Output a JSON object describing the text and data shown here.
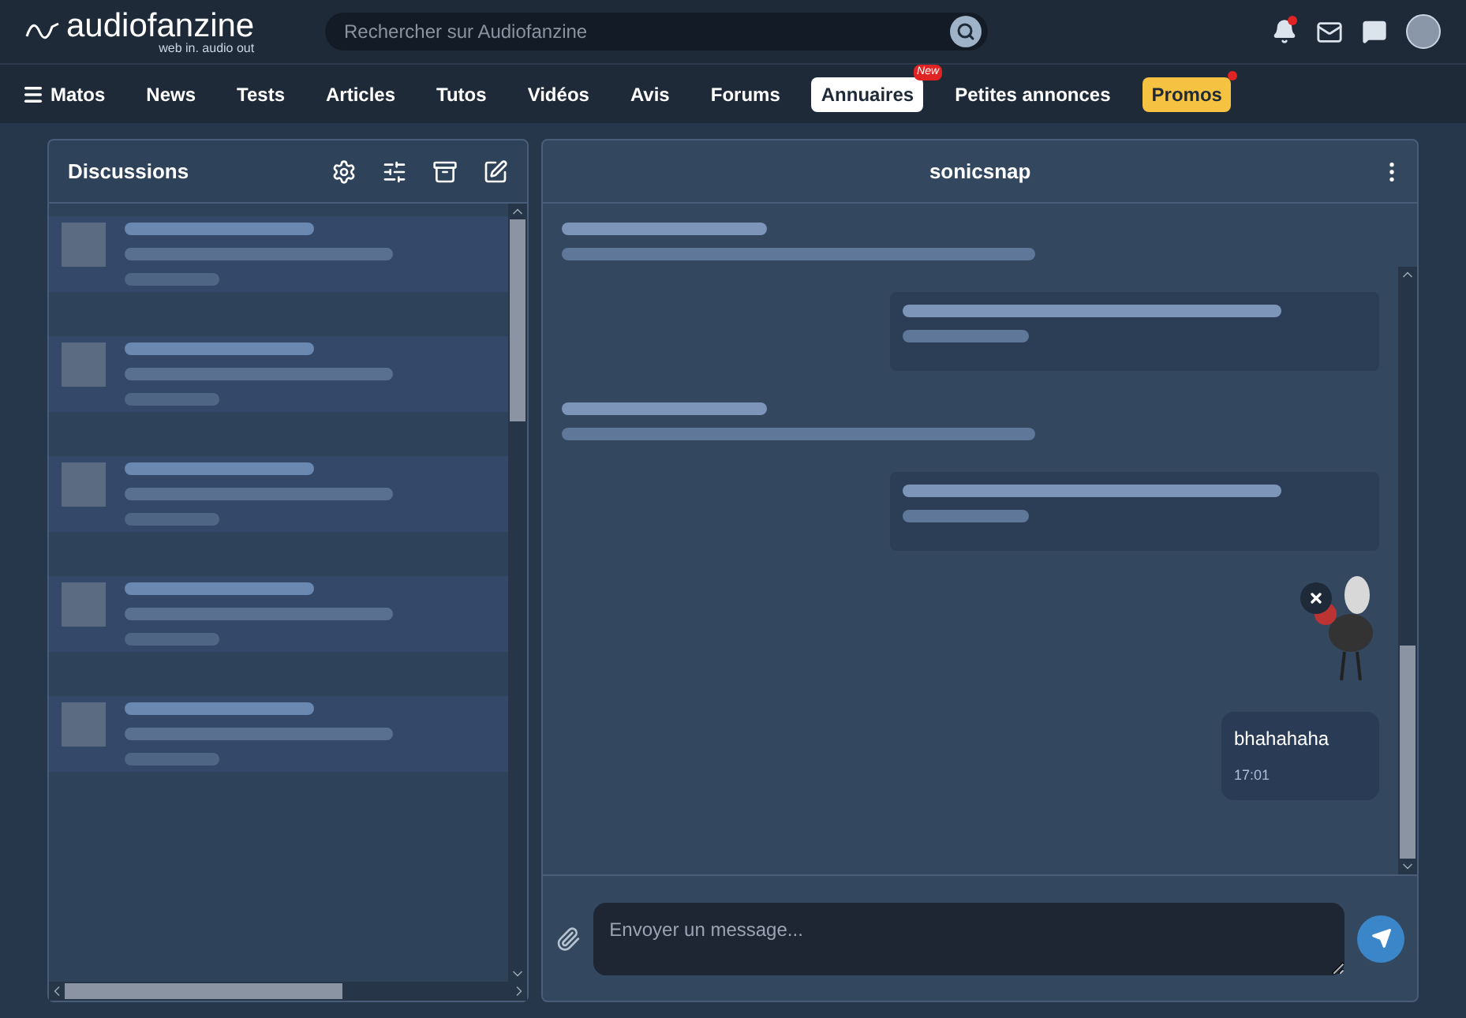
{
  "header": {
    "logo": "audiofanzine",
    "tagline": "web in. audio out",
    "search": {
      "placeholder": "Rechercher sur Audiofanzine"
    },
    "notifications_dot": true
  },
  "nav": [
    {
      "label": "Matos",
      "kind": "menu"
    },
    {
      "label": "News",
      "kind": "plain"
    },
    {
      "label": "Tests",
      "kind": "plain"
    },
    {
      "label": "Articles",
      "kind": "plain"
    },
    {
      "label": "Tutos",
      "kind": "plain"
    },
    {
      "label": "Vidéos",
      "kind": "plain"
    },
    {
      "label": "Avis",
      "kind": "plain"
    },
    {
      "label": "Forums",
      "kind": "plain"
    },
    {
      "label": "Annuaires",
      "kind": "highlight",
      "badge": "New"
    },
    {
      "label": "Petites annonces",
      "kind": "plain"
    },
    {
      "label": "Promos",
      "kind": "promo",
      "dot": true
    }
  ],
  "discussions": {
    "title": "Discussions",
    "items": [
      {
        "kind": "blurred"
      },
      {
        "kind": "blurred"
      },
      {
        "kind": "blurred"
      },
      {
        "kind": "blurred"
      },
      {
        "kind": "blurred"
      }
    ]
  },
  "chat": {
    "title": "sonicsnap",
    "messages": [
      {
        "kind": "blurred-in"
      },
      {
        "kind": "blurred-out"
      },
      {
        "kind": "blurred-in"
      },
      {
        "kind": "blurred-out"
      },
      {
        "kind": "sticker"
      },
      {
        "kind": "text",
        "text": "bhahahaha",
        "time": "17:01"
      }
    ],
    "composer": {
      "placeholder": "Envoyer un message..."
    }
  }
}
